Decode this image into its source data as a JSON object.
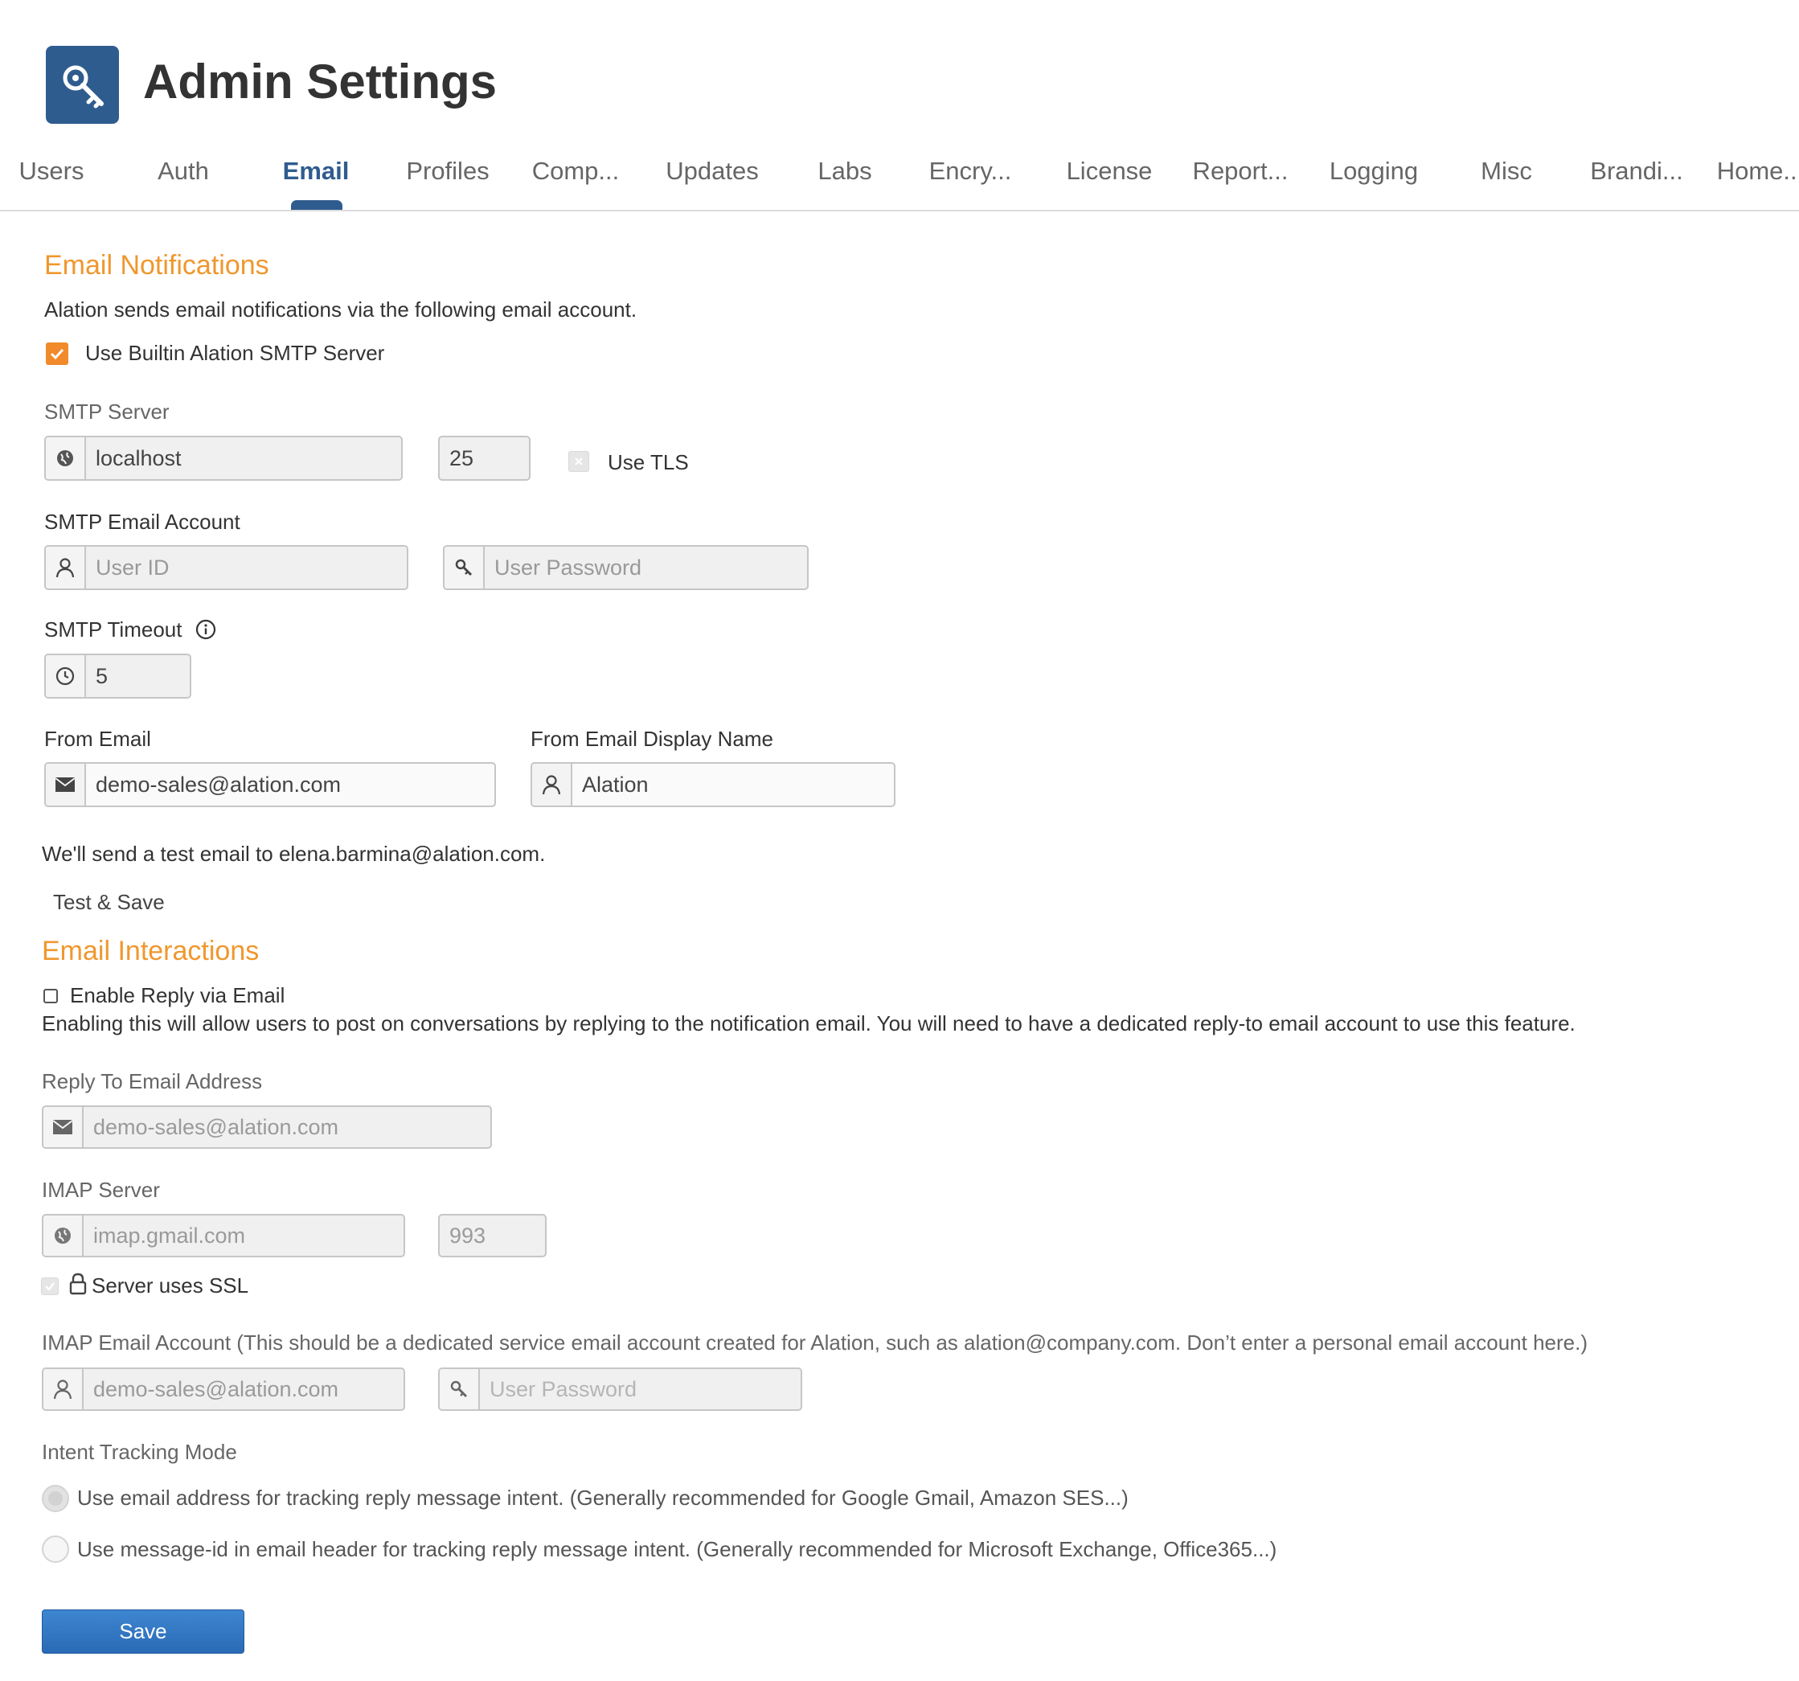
{
  "header": {
    "title": "Admin Settings",
    "icon": "key-icon",
    "icon_color": "#2f5c8f"
  },
  "tabs": [
    {
      "label": "Users"
    },
    {
      "label": "Auth"
    },
    {
      "label": "Email",
      "active": true
    },
    {
      "label": "Profiles"
    },
    {
      "label": "Comp..."
    },
    {
      "label": "Updates"
    },
    {
      "label": "Labs"
    },
    {
      "label": "Encry..."
    },
    {
      "label": "License"
    },
    {
      "label": "Report..."
    },
    {
      "label": "Logging"
    },
    {
      "label": "Misc"
    },
    {
      "label": "Brandi..."
    },
    {
      "label": "Home..."
    }
  ],
  "notifications": {
    "title": "Email Notifications",
    "description": "Alation sends email notifications via the following email account.",
    "builtin_label": "Use Builtin Alation SMTP Server",
    "builtin_checked": true,
    "smtp_server_label": "SMTP Server",
    "smtp_host": "localhost",
    "smtp_port": "25",
    "use_tls_label": "Use TLS",
    "account_label": "SMTP Email Account",
    "user_id_placeholder": "User ID",
    "password_placeholder": "User Password",
    "timeout_label": "SMTP Timeout",
    "timeout_value": "5",
    "from_email_label": "From Email",
    "from_email": "demo-sales@alation.com",
    "from_name_label": "From Email Display Name",
    "from_name": "Alation",
    "test_note": "We'll send a test email to elena.barmina@alation.com.",
    "test_save": "Test & Save"
  },
  "interactions": {
    "title": "Email Interactions",
    "enable_reply_label": "Enable Reply via Email",
    "enable_reply_checked": false,
    "enable_reply_help": "Enabling this will allow users to post on conversations by replying to the notification email. You will need to have a dedicated reply-to email account to use this feature.",
    "reply_to_label": "Reply To Email Address",
    "reply_to_value": "demo-sales@alation.com",
    "imap_server_label": "IMAP Server",
    "imap_host": "imap.gmail.com",
    "imap_port": "993",
    "ssl_label": "Server uses SSL",
    "imap_account_label": "IMAP Email Account (This should be a dedicated service email account created for Alation, such as alation@company.com. Don’t enter a personal email account here.)",
    "imap_user": "demo-sales@alation.com",
    "imap_password_placeholder": "User Password",
    "intent_label": "Intent Tracking Mode",
    "intent_options": [
      "Use email address for tracking reply message intent. (Generally recommended for Google Gmail, Amazon SES...)",
      "Use message-id in email header for tracking reply message intent. (Generally recommended for Microsoft Exchange, Office365...)"
    ],
    "intent_selected": 0
  },
  "save_label": "Save",
  "colors": {
    "accent_orange": "#f0972e",
    "brand_blue": "#2f5c8f",
    "button_blue": "#2f72be"
  }
}
